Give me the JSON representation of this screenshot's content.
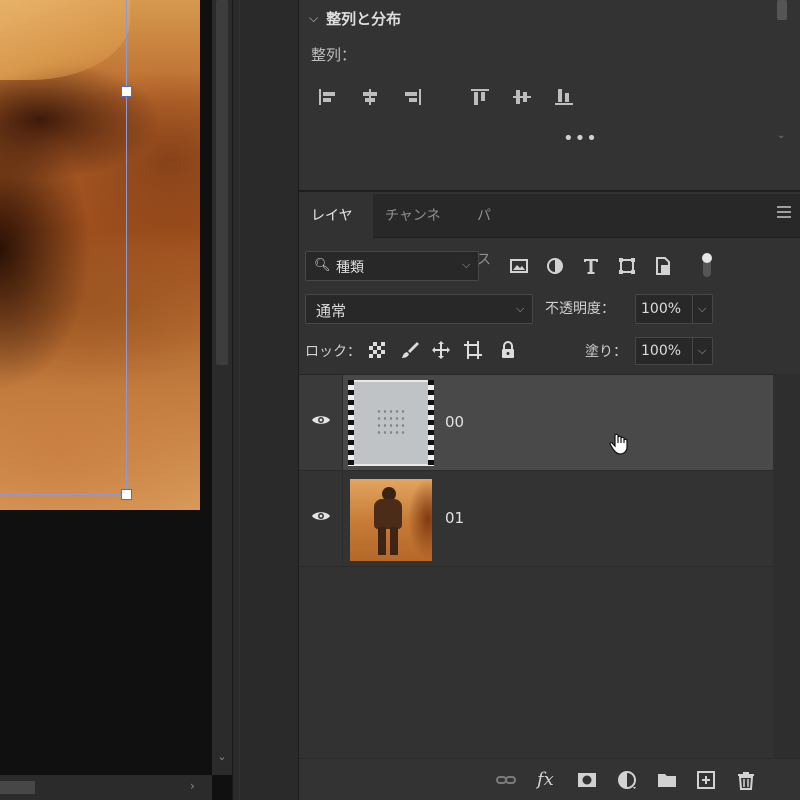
{
  "align_panel": {
    "title": "整列と分布",
    "align_label": "整列：",
    "more": "•••",
    "align_icons": [
      "align-left-edges-icon",
      "align-horizontal-centers-icon",
      "align-right-edges-icon",
      "align-top-edges-icon",
      "align-vertical-centers-icon",
      "align-bottom-edges-icon"
    ]
  },
  "layers_panel": {
    "tabs": [
      {
        "label": "レイヤー",
        "active": true
      },
      {
        "label": "チャンネル",
        "active": false
      },
      {
        "label": "パス",
        "active": false
      }
    ],
    "filter": {
      "label": "種類",
      "icons": [
        "pixel-layer-filter-icon",
        "adjustment-layer-filter-icon",
        "type-layer-filter-icon",
        "shape-layer-filter-icon",
        "smart-object-filter-icon",
        "filter-toggle-icon"
      ]
    },
    "blend_mode": "通常",
    "opacity_label": "不透明度：",
    "opacity_value": "100%",
    "lock_label": "ロック：",
    "lock_icons": [
      "lock-transparent-pixels-icon",
      "lock-image-pixels-icon",
      "lock-position-icon",
      "lock-artboard-icon",
      "lock-all-icon"
    ],
    "fill_label": "塗り：",
    "fill_value": "100%",
    "layers": [
      {
        "name": "00",
        "visible": true,
        "selected": true
      },
      {
        "name": "01",
        "visible": true,
        "selected": false
      }
    ],
    "bottom_icons": [
      "link-layers-icon",
      "layer-style-fx-icon",
      "add-mask-icon",
      "new-adjustment-layer-icon",
      "new-group-icon",
      "new-layer-icon",
      "delete-layer-icon"
    ],
    "fx_label": "fx"
  },
  "colors": {
    "panel_bg": "#323232",
    "selected_row": "#494949",
    "transform_box": "#8a9bd6",
    "canvas_bg": "#101010"
  }
}
